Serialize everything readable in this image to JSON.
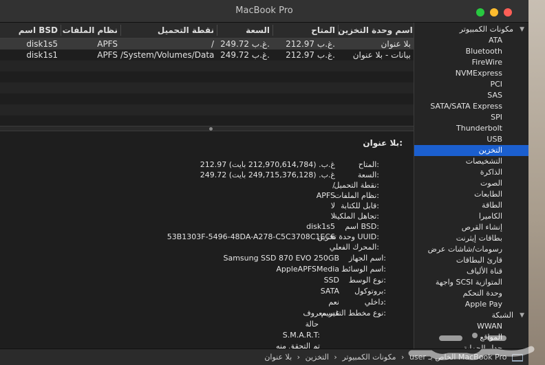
{
  "window": {
    "title": "MacBook Pro",
    "colors": {
      "close": "#ff5f57",
      "minimize": "#febc2e",
      "zoom": "#28c840",
      "selection": "#1b5fcf"
    }
  },
  "table": {
    "headers": {
      "name": "اسم وحدة التخزين",
      "available": "المتاح",
      "capacity": "السعة",
      "mount": "نقطة التحميل",
      "fs": "نظام الملفات",
      "bsd": "اسم BSD"
    },
    "rows": [
      {
        "name": "بلا عنوان",
        "available": "212.97 غ.ب.",
        "capacity": "249.72 غ.ب.",
        "mount": "/",
        "fs": "APFS",
        "bsd": "disk1s5"
      },
      {
        "name": "بيانات - بلا عنوان",
        "available": "212.97 غ.ب.",
        "capacity": "249.72 غ.ب.",
        "mount": "/System/Volumes/Data",
        "fs": "APFS",
        "bsd": "disk1s1"
      }
    ]
  },
  "details": {
    "heading": "بلا عنوان:",
    "fields": [
      {
        "label": "المتاح:",
        "value": "212.97 غ.ب. (212,970,614,784 بايت)"
      },
      {
        "label": "السعة:",
        "value": "249.72 غ.ب. (249,715,376,128 بايت)"
      },
      {
        "label": "نقطة التحميل:",
        "value": "/"
      },
      {
        "label": "نظام الملفات:",
        "value": "APFS"
      },
      {
        "label": "قابل للكتابة:",
        "value": "لا"
      },
      {
        "label": "تجاهل الملكية:",
        "value": "لا"
      },
      {
        "label": "اسم BSD:",
        "value": "disk1s5"
      },
      {
        "label": "وحدة تخزين UUID:",
        "value": "53B1303F-5496-48DA-A278-C5C3708C1EC6"
      }
    ],
    "physical_heading": "المحرك الفعلي:",
    "physical": [
      {
        "label": "اسم الجهاز:",
        "value": "Samsung SSD 870 EVO 250GB"
      },
      {
        "label": "اسم الوسائط:",
        "value": "AppleAPFSMedia"
      },
      {
        "label": "نوع الوسط:",
        "value": "SSD"
      },
      {
        "label": "بروتوكول:",
        "value": "SATA"
      },
      {
        "label": "داخلي:",
        "value": "نعم"
      },
      {
        "label": "نوع مخطط التقسيم:",
        "value": "غير معروف"
      }
    ],
    "smart_state": "حالة",
    "smart_label": "S.M.A.R.T:",
    "verified": "تم التحقق منه"
  },
  "sidebar": {
    "items": [
      {
        "label": "مكونات الكمبيوتر",
        "group": true,
        "selected": false
      },
      {
        "label": "ATA",
        "group": false,
        "selected": false
      },
      {
        "label": "Bluetooth",
        "group": false,
        "selected": false
      },
      {
        "label": "FireWire",
        "group": false,
        "selected": false
      },
      {
        "label": "NVMExpress",
        "group": false,
        "selected": false
      },
      {
        "label": "PCI",
        "group": false,
        "selected": false
      },
      {
        "label": "SAS",
        "group": false,
        "selected": false
      },
      {
        "label": "SATA/SATA Express",
        "group": false,
        "selected": false
      },
      {
        "label": "SPI",
        "group": false,
        "selected": false
      },
      {
        "label": "Thunderbolt",
        "group": false,
        "selected": false
      },
      {
        "label": "USB",
        "group": false,
        "selected": false
      },
      {
        "label": "التخزين",
        "group": false,
        "selected": true
      },
      {
        "label": "التشخيصات",
        "group": false,
        "selected": false
      },
      {
        "label": "الذاكرة",
        "group": false,
        "selected": false
      },
      {
        "label": "الصوت",
        "group": false,
        "selected": false
      },
      {
        "label": "الطابعات",
        "group": false,
        "selected": false
      },
      {
        "label": "الطاقة",
        "group": false,
        "selected": false
      },
      {
        "label": "الكاميرا",
        "group": false,
        "selected": false
      },
      {
        "label": "إنشاء القرص",
        "group": false,
        "selected": false
      },
      {
        "label": "بطاقات إيثرنت",
        "group": false,
        "selected": false
      },
      {
        "label": "رسومات/شاشات عرض",
        "group": false,
        "selected": false
      },
      {
        "label": "قارئ البطاقات",
        "group": false,
        "selected": false
      },
      {
        "label": "قناة الألياف",
        "group": false,
        "selected": false
      },
      {
        "label": "واجهة SCSI المتوازية",
        "group": false,
        "selected": false
      },
      {
        "label": "وحدة التحكم",
        "group": false,
        "selected": false
      },
      {
        "label": "Apple Pay",
        "group": false,
        "selected": false
      },
      {
        "label": "الشبكة",
        "group": true,
        "selected": false
      },
      {
        "label": "WWAN",
        "group": false,
        "selected": false
      },
      {
        "label": "المواقع",
        "group": false,
        "selected": false
      },
      {
        "label": "جدار الحماية",
        "group": false,
        "selected": false
      }
    ]
  },
  "statusbar": {
    "crumbs": [
      "MacBook Pro الخاص بـ user",
      "مكونات الكمبيوتر",
      "التخزين",
      "بلا عنوان"
    ],
    "separator": "‹"
  },
  "watermark": {
    "text": "حراج"
  }
}
